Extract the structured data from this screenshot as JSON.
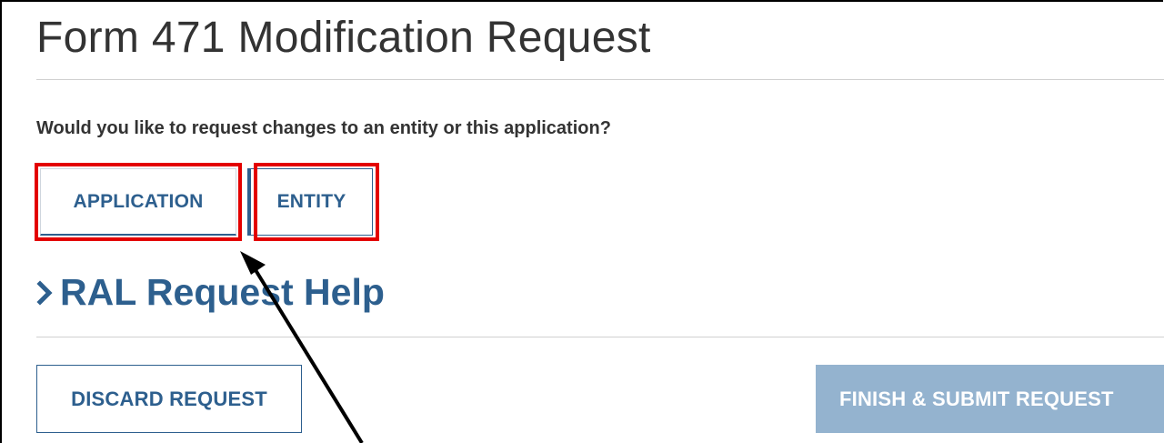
{
  "page": {
    "title": "Form 471 Modification Request",
    "question": "Would you like to request changes to an entity or this application?"
  },
  "options": {
    "application_label": "APPLICATION",
    "entity_label": "ENTITY"
  },
  "help": {
    "label": "RAL Request Help",
    "icon": "chevron-right-icon"
  },
  "actions": {
    "discard_label": "DISCARD REQUEST",
    "submit_label": "FINISH & SUBMIT REQUEST",
    "submit_enabled": false
  },
  "annotation": {
    "highlight_color": "#e30000",
    "arrow_color": "#000000"
  },
  "colors": {
    "primary": "#2d5f8e",
    "disabled_button": "#94b3cf",
    "text": "#333333"
  }
}
